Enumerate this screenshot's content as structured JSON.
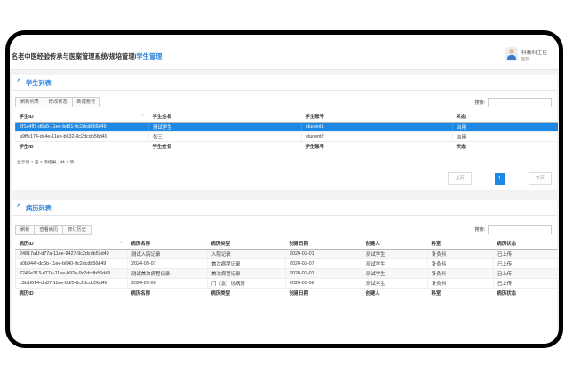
{
  "header": {
    "crumb_main": "名老中医经验传承与医案管理系统/规培管理/",
    "crumb_current": "学生管理",
    "user_name": "科教科王佳",
    "user_role": "医院"
  },
  "students": {
    "title": "学生列表",
    "buttons": [
      "刷新列表",
      "修改状态",
      "新建账号"
    ],
    "search_label": "搜索:",
    "columns": [
      "学生ID",
      "学生姓名",
      "学生账号",
      "状态"
    ],
    "rows": [
      [
        "2f1a4ff1-d6a5-11ee-bd51-9c2dcdb56d49",
        "测试学生",
        "student1",
        "启用"
      ],
      [
        "a9ffe174-dc4e-11ee-b632-9c2dcdb56d49",
        "张三",
        "student2",
        "启用"
      ]
    ],
    "info": "显示第 1 至 2 项结果，共 2 项",
    "prev": "上页",
    "page": "1",
    "next": "下页"
  },
  "records": {
    "title": "病历列表",
    "buttons": [
      "刷新",
      "查看病历",
      "修订历史"
    ],
    "search_label": "搜索:",
    "columns": [
      "病历ID",
      "病历名称",
      "病历类型",
      "创建日期",
      "创建人",
      "科室",
      "病历状态"
    ],
    "rows": [
      [
        "24817a1f-d77a-11ee-9427-9c2dcdb56d49",
        "测试入院记录",
        "入院记录",
        "2024-03-01",
        "测试学生",
        "针灸科",
        "已上传"
      ],
      [
        "a0b944f-dc6b-11ee-b640-9c2dcdb56d49",
        "2024-03-07",
        "首次病程记录",
        "2024-03-07",
        "测试学生",
        "针灸科",
        "已上传"
      ],
      [
        "7246e313-d77a-11ee-b92e-9c2dcdb56d49",
        "测试首次病程记录",
        "首次病程记录",
        "2024-03-01",
        "测试学生",
        "针灸科",
        "已上传"
      ],
      [
        "c9b1f614-db87-11ee-8df5-9c2dcdb56d49",
        "2024-03-06",
        "门（急）诊病历",
        "2024-03-06",
        "测试学生",
        "针灸科",
        "已上传"
      ]
    ]
  }
}
